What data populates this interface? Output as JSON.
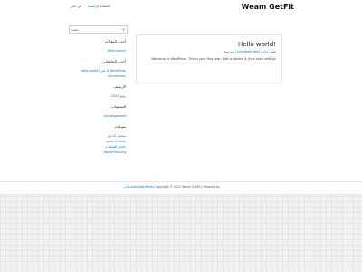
{
  "header": {
    "site_title": "Weam GetFit",
    "nav": [
      "الصفحة الرئيسية",
      "من نحن"
    ]
  },
  "search": {
    "icon": "search-icon",
    "button_label": "بحث"
  },
  "sidebar": {
    "recent_posts": {
      "title": "أحدث المقالات",
      "items": [
        "Hello world!"
      ]
    },
    "recent_comments": {
      "title": "أحدث التعليقات",
      "items": [
        "Hello world! على A WordPress Commenter"
      ]
    },
    "archives": {
      "title": "الأرشيف",
      "items": [
        "يونيو 2021"
      ]
    },
    "categories": {
      "title": "التصنيفات",
      "items": [
        "Uncategorized"
      ]
    },
    "meta": {
      "title": "منوعات",
      "items": [
        "تسجيل الدخول",
        "خلاصة Entries",
        "خلاصة التعليقات",
        "WordPress.org"
      ]
    }
  },
  "post": {
    "title": "Hello world!",
    "meta": "منذ سنة / Uncategorized / تعليق واحد",
    "excerpt": "Welcome to WordPress. This is your first post. Edit or delete it, then start writing!"
  },
  "footer": {
    "text": "Copyright © 2021 Weam GetFit | Powered by",
    "link": "قالب Astra WordPress"
  }
}
